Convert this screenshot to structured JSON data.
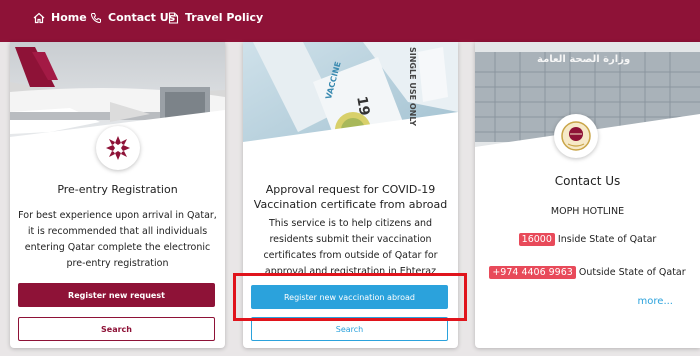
{
  "nav": {
    "home": "Home",
    "contact": "Contact Us",
    "travel_policy": "Travel Policy"
  },
  "cards": [
    {
      "title": "Pre-entry Registration",
      "description": "For best experience upon arrival in Qatar, it is recommended that all individuals entering Qatar complete the electronic pre-entry registration",
      "primary_button": "Register new request",
      "secondary_button": "Search"
    },
    {
      "title": "Approval request for COVID-19 Vaccination certificate from abroad",
      "description": "This service is to help citizens and residents submit their vaccination certificates from outside of Qatar for approval and registration in Ehteraz",
      "primary_button": "Register new vaccination abroad",
      "secondary_button": "Search",
      "hero_texts": {
        "vaccine": "VACCINE",
        "single_use": "SINGLE USE ONLY",
        "number": "19"
      }
    },
    {
      "title": "Contact Us",
      "hotline_heading": "MOPH HOTLINE",
      "hotlines": [
        {
          "number": "16000",
          "label": "Inside State of Qatar"
        },
        {
          "number": "+974 4406 9963",
          "label": "Outside State of Qatar"
        }
      ],
      "more_link": "more...",
      "hero_sign": "وزارة الصحة العامة"
    }
  ],
  "colors": {
    "brand": "#8e1237",
    "accent_blue": "#2ba2dc",
    "highlight": "#e0141c",
    "pill": "#e84a5a"
  },
  "icons": [
    "home-icon",
    "phone-icon",
    "document-icon"
  ]
}
